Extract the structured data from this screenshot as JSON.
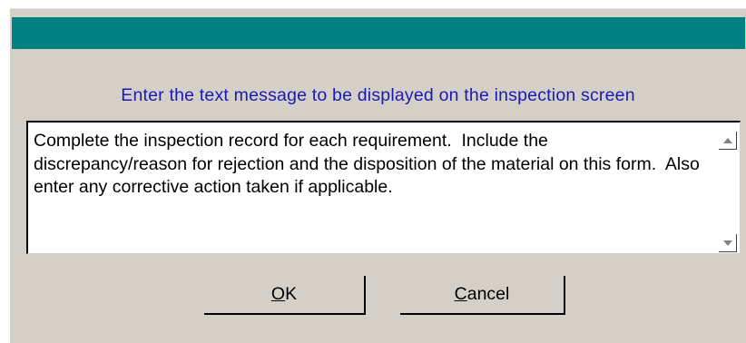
{
  "window": {
    "title_bar_color": "#008080",
    "background_color": "#d4d0c8"
  },
  "prompt": {
    "text": "Enter the text message to be displayed on the inspection screen",
    "color": "#1a1ab8"
  },
  "message": {
    "value": "Complete the inspection record for each requirement.  Include the discrepancy/reason for rejection and the disposition of the material on this form.  Also enter any corrective action taken if applicable."
  },
  "scrollbar": {
    "up_icon": "scroll-up-arrow",
    "down_icon": "scroll-down-arrow"
  },
  "buttons": {
    "ok": {
      "accel": "O",
      "rest": "K"
    },
    "cancel": {
      "accel": "C",
      "rest": "ancel"
    }
  }
}
